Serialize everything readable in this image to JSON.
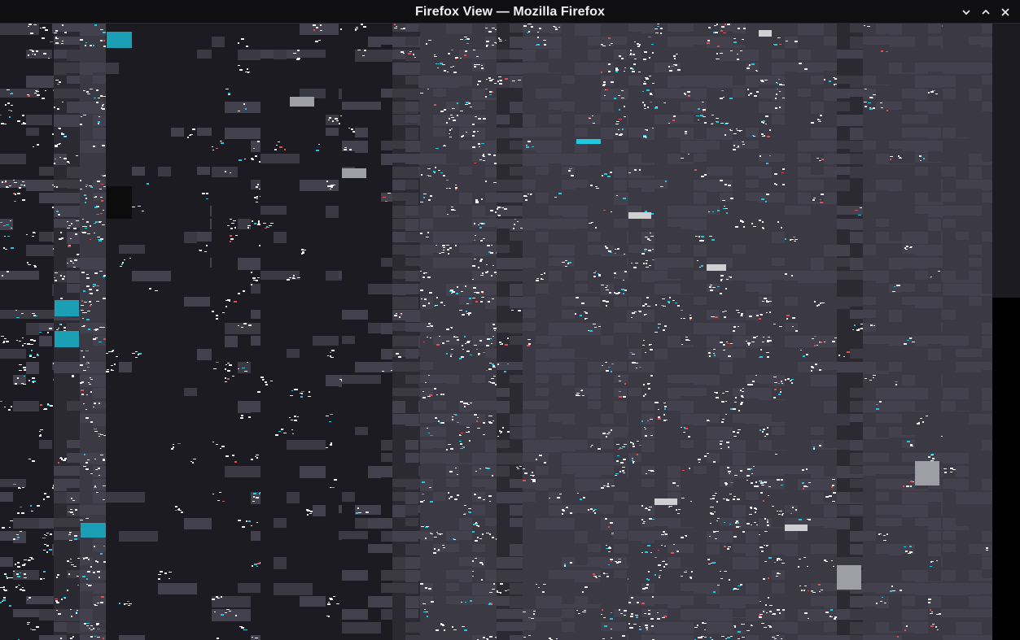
{
  "window": {
    "title": "Firefox View — Mozilla Firefox",
    "controls": [
      {
        "name": "minimize",
        "icon": "chevron-down-icon"
      },
      {
        "name": "maximize",
        "icon": "chevron-up-icon"
      },
      {
        "name": "close",
        "icon": "close-icon"
      }
    ]
  },
  "content": {
    "state": "rendering-glitch",
    "colors": {
      "background": "#1c1b22",
      "tile_dark": "#2b2a33",
      "tile_mid": "#3a3944",
      "tile_light": "#42414d",
      "accent_teal": "#1a9fb4",
      "accent_cyan": "#20c8e0",
      "noise_white": "#f5f5f7",
      "block_gray": "#9e9ea6",
      "block_black": "#0c0c0d"
    }
  }
}
